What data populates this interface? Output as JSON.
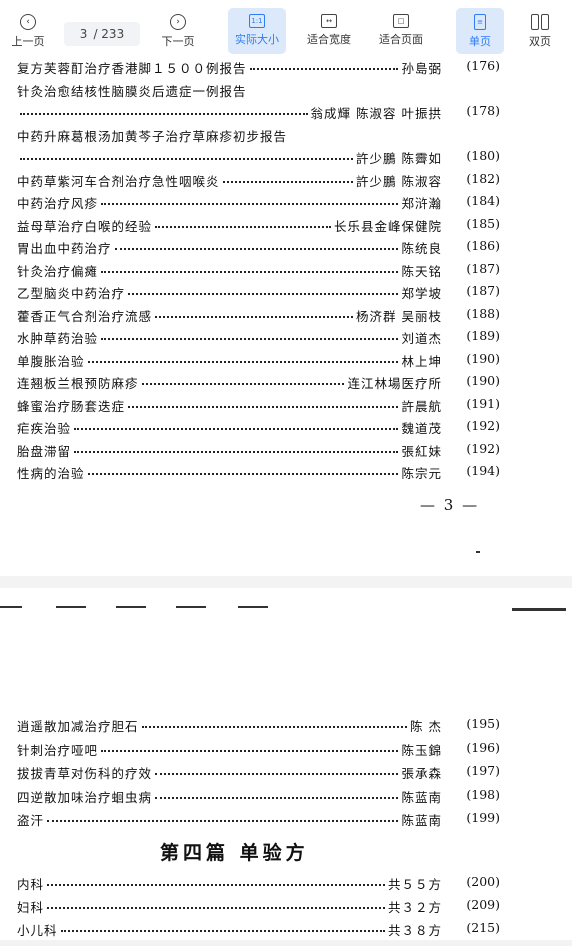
{
  "toolbar": {
    "prev": "上一页",
    "page_current": "3",
    "page_total": "/ 233",
    "next": "下一页",
    "actual_size": "实际大小",
    "fit_width": "适合宽度",
    "fit_page": "适合页面",
    "single_page": "单页",
    "double_page": "双页",
    "accent_color": "#2f7cf6"
  },
  "page1": {
    "entries": [
      {
        "title": "复方芙蓉酊治疗香港脚１５００例报告",
        "author": "孙島弼",
        "page": "(176)"
      },
      {
        "title": "针灸治愈结核性脑膜炎后遗症一例报告",
        "author": "",
        "page": ""
      },
      {
        "title": "",
        "author": "翁成輝  陈淑容  叶振拱",
        "page": "(178)"
      },
      {
        "title": "中药升麻葛根汤加黄芩子治疗草麻疹初步报告",
        "author": "",
        "page": ""
      },
      {
        "title": "",
        "author": "許少鵬  陈霽如",
        "page": "(180)"
      },
      {
        "title": "中药草紫河车合剂治疗急性咽喉炎",
        "author": "許少鵬  陈淑容",
        "page": "(182)"
      },
      {
        "title": "中药治疗风疹",
        "author": "郑浒瀚",
        "page": "(184)"
      },
      {
        "title": "益母草治疗白喉的经验",
        "author": "长乐县金峰保健院",
        "page": "(185)"
      },
      {
        "title": "胃出血中药治疗",
        "author": "陈统良",
        "page": "(186)"
      },
      {
        "title": "针灸治疗偏瘫",
        "author": "陈天铭",
        "page": "(187)"
      },
      {
        "title": "乙型脑炎中药治疗",
        "author": "郑学坡",
        "page": "(187)"
      },
      {
        "title": "藿香正气合剂治疗流感",
        "author": "杨济群  吴丽枝",
        "page": "(188)"
      },
      {
        "title": "水肿草药治验",
        "author": "刘道杰",
        "page": "(189)"
      },
      {
        "title": "单腹胀治验",
        "author": "林上坤",
        "page": "(190)"
      },
      {
        "title": "连翘板兰根预防麻疹",
        "author": "连江林場医疗所",
        "page": "(190)"
      },
      {
        "title": "蜂蜜治疗肠套迭症",
        "author": "許晨航",
        "page": "(191)"
      },
      {
        "title": "疟疾治验",
        "author": "魏道茂",
        "page": "(192)"
      },
      {
        "title": "胎盘滞留",
        "author": "張紅妹",
        "page": "(192)"
      },
      {
        "title": "性病的治验",
        "author": "陈宗元",
        "page": "(194)"
      }
    ],
    "page_number": "— 3 —"
  },
  "page2": {
    "entries": [
      {
        "title": "逍遥散加减治疗胆石",
        "author": "陈  杰",
        "page": "(195)"
      },
      {
        "title": "针刺治疗哑吧",
        "author": "陈玉錦",
        "page": "(196)"
      },
      {
        "title": "拔拔青草对伤科的疗效",
        "author": "張承森",
        "page": "(197)"
      },
      {
        "title": "四逆散加味治疗蛔虫病",
        "author": "陈蓝南",
        "page": "(198)"
      },
      {
        "title": "盗汗",
        "author": "陈蓝南",
        "page": "(199)"
      }
    ],
    "section_title": "第四篇  单验方",
    "section_entries": [
      {
        "title": "内科",
        "author": "共５５方",
        "page": "(200)"
      },
      {
        "title": "妇科",
        "author": "共３２方",
        "page": "(209)"
      },
      {
        "title": "小儿科",
        "author": "共３８方",
        "page": "(215)"
      }
    ]
  }
}
